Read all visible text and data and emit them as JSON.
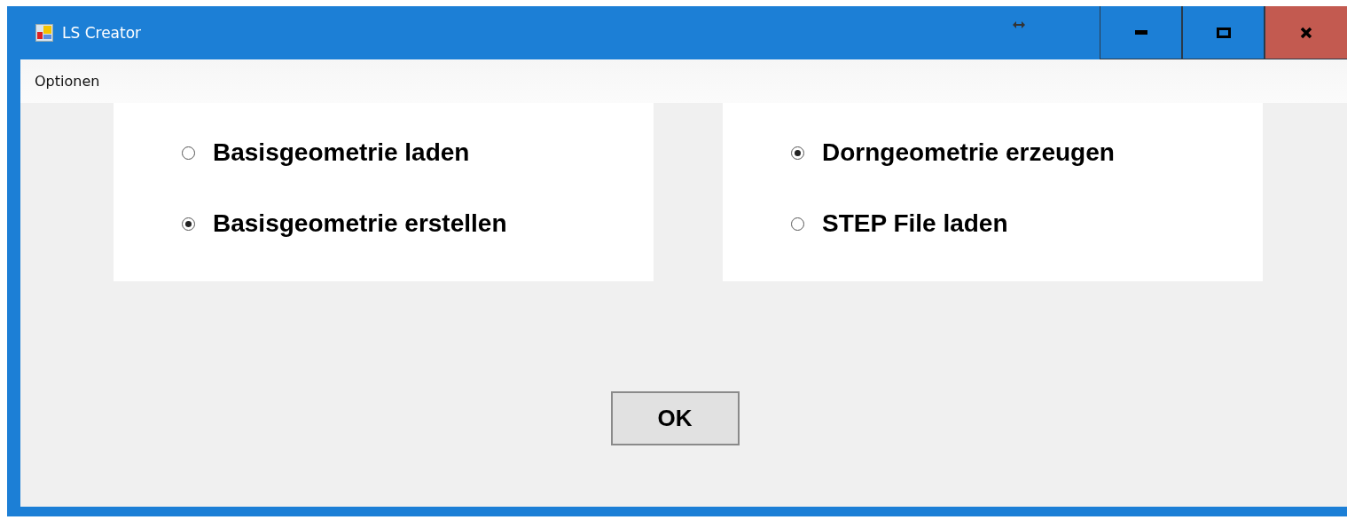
{
  "window": {
    "title": "LS Creator"
  },
  "menu": [
    {
      "label": "Optionen"
    }
  ],
  "groups": [
    {
      "options": [
        {
          "label": "Basisgeometrie laden",
          "selected": false
        },
        {
          "label": "Basisgeometrie erstellen",
          "selected": true
        }
      ]
    },
    {
      "options": [
        {
          "label": "Dorngeometrie erzeugen",
          "selected": true
        },
        {
          "label": "STEP File laden",
          "selected": false
        }
      ]
    }
  ],
  "buttons": [
    {
      "label": "OK"
    }
  ]
}
